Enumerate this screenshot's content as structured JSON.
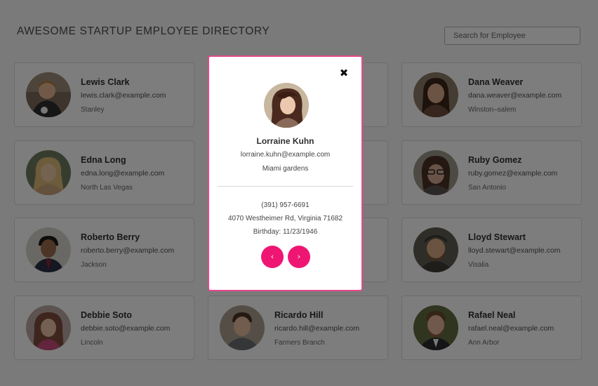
{
  "header": {
    "title": "AWESOME STARTUP EMPLOYEE DIRECTORY",
    "search_placeholder": "Search for Employee"
  },
  "employees": [
    {
      "name": "Lewis Clark",
      "email": "lewis.clark@example.com",
      "city": "Stanley"
    },
    {
      "name": "Dana Weaver",
      "email": "dana.weaver@example.com",
      "city": "Winston–salem"
    },
    {
      "name": "Edna Long",
      "email": "edna.long@example.com",
      "city": "North Las Vegas"
    },
    {
      "name": "Ruby Gomez",
      "email": "ruby.gomez@example.com",
      "city": "San Antonio"
    },
    {
      "name": "Roberto Berry",
      "email": "roberto.berry@example.com",
      "city": "Jackson"
    },
    {
      "name": "Lloyd Stewart",
      "email": "lloyd.stewart@example.com",
      "city": "Visalia"
    },
    {
      "name": "Debbie Soto",
      "email": "debbie.soto@example.com",
      "city": "Lincoln"
    },
    {
      "name": "Ricardo Hill",
      "email": "ricardo.hill@example.com",
      "city": "Farmers Branch"
    },
    {
      "name": "Rafael Neal",
      "email": "rafael.neal@example.com",
      "city": "Ann Arbor"
    }
  ],
  "modal": {
    "close_icon": "close-icon",
    "name": "Lorraine Kuhn",
    "email": "lorraine.kuhn@example.com",
    "city": "Miami gardens",
    "phone": "(391) 957-6691",
    "address": "4070 Westheimer Rd, Virginia 71682",
    "birthday": "Birthday: 11/23/1946",
    "prev_icon": "‹",
    "next_icon": "›"
  },
  "colors": {
    "accent": "#ef1673",
    "modal_border": "#e5488c",
    "overlay": "rgba(0,0,0,0.5)"
  }
}
